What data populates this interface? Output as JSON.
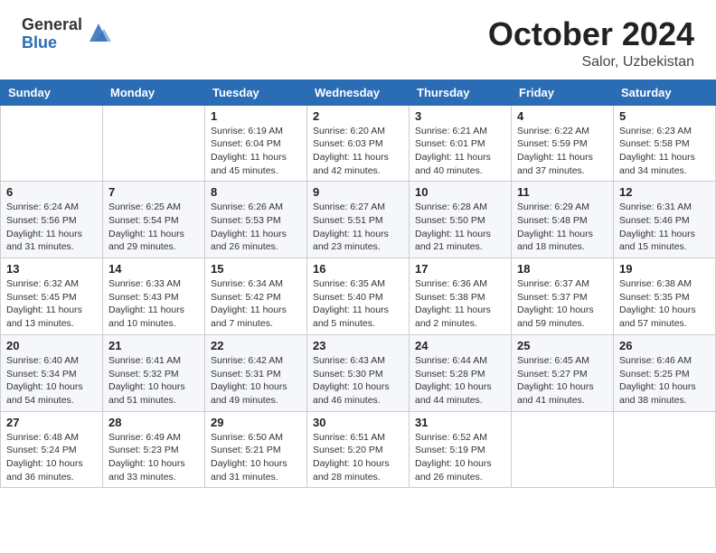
{
  "header": {
    "logo_general": "General",
    "logo_blue": "Blue",
    "month_year": "October 2024",
    "subtitle": "Salor, Uzbekistan"
  },
  "columns": [
    "Sunday",
    "Monday",
    "Tuesday",
    "Wednesday",
    "Thursday",
    "Friday",
    "Saturday"
  ],
  "weeks": [
    [
      {
        "day": "",
        "info": ""
      },
      {
        "day": "",
        "info": ""
      },
      {
        "day": "1",
        "info": "Sunrise: 6:19 AM\nSunset: 6:04 PM\nDaylight: 11 hours and 45 minutes."
      },
      {
        "day": "2",
        "info": "Sunrise: 6:20 AM\nSunset: 6:03 PM\nDaylight: 11 hours and 42 minutes."
      },
      {
        "day": "3",
        "info": "Sunrise: 6:21 AM\nSunset: 6:01 PM\nDaylight: 11 hours and 40 minutes."
      },
      {
        "day": "4",
        "info": "Sunrise: 6:22 AM\nSunset: 5:59 PM\nDaylight: 11 hours and 37 minutes."
      },
      {
        "day": "5",
        "info": "Sunrise: 6:23 AM\nSunset: 5:58 PM\nDaylight: 11 hours and 34 minutes."
      }
    ],
    [
      {
        "day": "6",
        "info": "Sunrise: 6:24 AM\nSunset: 5:56 PM\nDaylight: 11 hours and 31 minutes."
      },
      {
        "day": "7",
        "info": "Sunrise: 6:25 AM\nSunset: 5:54 PM\nDaylight: 11 hours and 29 minutes."
      },
      {
        "day": "8",
        "info": "Sunrise: 6:26 AM\nSunset: 5:53 PM\nDaylight: 11 hours and 26 minutes."
      },
      {
        "day": "9",
        "info": "Sunrise: 6:27 AM\nSunset: 5:51 PM\nDaylight: 11 hours and 23 minutes."
      },
      {
        "day": "10",
        "info": "Sunrise: 6:28 AM\nSunset: 5:50 PM\nDaylight: 11 hours and 21 minutes."
      },
      {
        "day": "11",
        "info": "Sunrise: 6:29 AM\nSunset: 5:48 PM\nDaylight: 11 hours and 18 minutes."
      },
      {
        "day": "12",
        "info": "Sunrise: 6:31 AM\nSunset: 5:46 PM\nDaylight: 11 hours and 15 minutes."
      }
    ],
    [
      {
        "day": "13",
        "info": "Sunrise: 6:32 AM\nSunset: 5:45 PM\nDaylight: 11 hours and 13 minutes."
      },
      {
        "day": "14",
        "info": "Sunrise: 6:33 AM\nSunset: 5:43 PM\nDaylight: 11 hours and 10 minutes."
      },
      {
        "day": "15",
        "info": "Sunrise: 6:34 AM\nSunset: 5:42 PM\nDaylight: 11 hours and 7 minutes."
      },
      {
        "day": "16",
        "info": "Sunrise: 6:35 AM\nSunset: 5:40 PM\nDaylight: 11 hours and 5 minutes."
      },
      {
        "day": "17",
        "info": "Sunrise: 6:36 AM\nSunset: 5:38 PM\nDaylight: 11 hours and 2 minutes."
      },
      {
        "day": "18",
        "info": "Sunrise: 6:37 AM\nSunset: 5:37 PM\nDaylight: 10 hours and 59 minutes."
      },
      {
        "day": "19",
        "info": "Sunrise: 6:38 AM\nSunset: 5:35 PM\nDaylight: 10 hours and 57 minutes."
      }
    ],
    [
      {
        "day": "20",
        "info": "Sunrise: 6:40 AM\nSunset: 5:34 PM\nDaylight: 10 hours and 54 minutes."
      },
      {
        "day": "21",
        "info": "Sunrise: 6:41 AM\nSunset: 5:32 PM\nDaylight: 10 hours and 51 minutes."
      },
      {
        "day": "22",
        "info": "Sunrise: 6:42 AM\nSunset: 5:31 PM\nDaylight: 10 hours and 49 minutes."
      },
      {
        "day": "23",
        "info": "Sunrise: 6:43 AM\nSunset: 5:30 PM\nDaylight: 10 hours and 46 minutes."
      },
      {
        "day": "24",
        "info": "Sunrise: 6:44 AM\nSunset: 5:28 PM\nDaylight: 10 hours and 44 minutes."
      },
      {
        "day": "25",
        "info": "Sunrise: 6:45 AM\nSunset: 5:27 PM\nDaylight: 10 hours and 41 minutes."
      },
      {
        "day": "26",
        "info": "Sunrise: 6:46 AM\nSunset: 5:25 PM\nDaylight: 10 hours and 38 minutes."
      }
    ],
    [
      {
        "day": "27",
        "info": "Sunrise: 6:48 AM\nSunset: 5:24 PM\nDaylight: 10 hours and 36 minutes."
      },
      {
        "day": "28",
        "info": "Sunrise: 6:49 AM\nSunset: 5:23 PM\nDaylight: 10 hours and 33 minutes."
      },
      {
        "day": "29",
        "info": "Sunrise: 6:50 AM\nSunset: 5:21 PM\nDaylight: 10 hours and 31 minutes."
      },
      {
        "day": "30",
        "info": "Sunrise: 6:51 AM\nSunset: 5:20 PM\nDaylight: 10 hours and 28 minutes."
      },
      {
        "day": "31",
        "info": "Sunrise: 6:52 AM\nSunset: 5:19 PM\nDaylight: 10 hours and 26 minutes."
      },
      {
        "day": "",
        "info": ""
      },
      {
        "day": "",
        "info": ""
      }
    ]
  ]
}
